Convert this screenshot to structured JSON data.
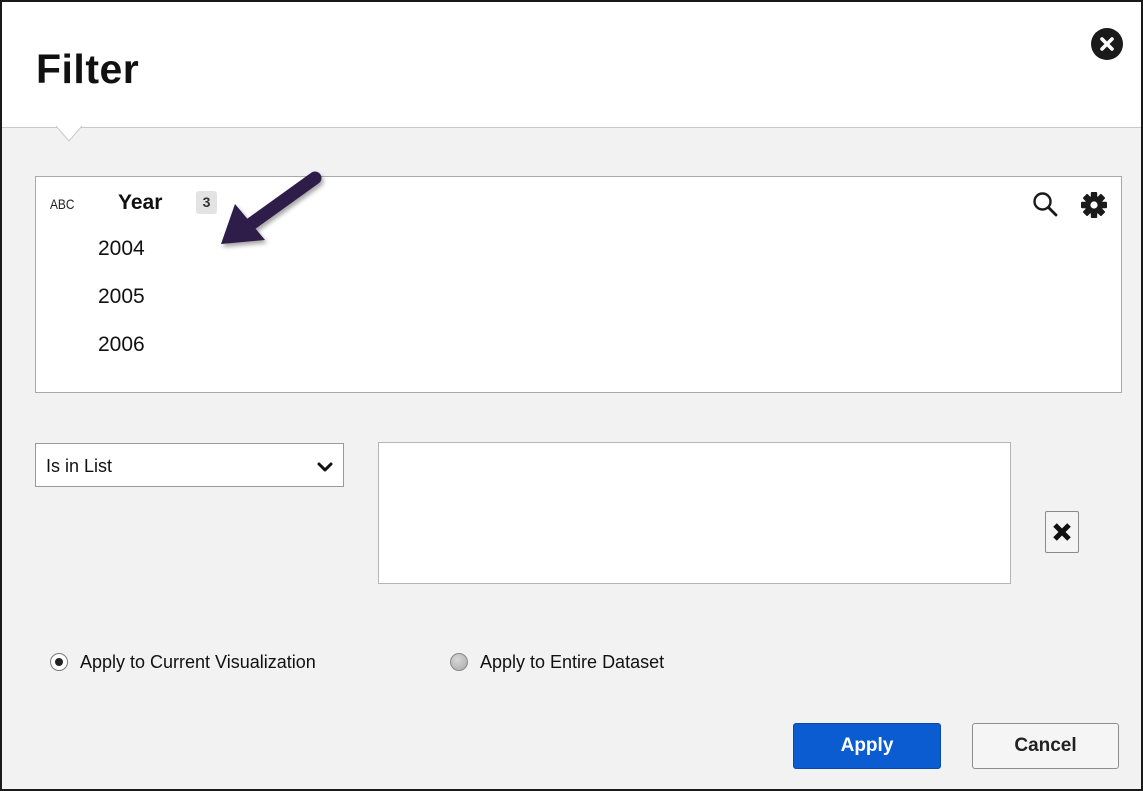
{
  "dialog": {
    "title": "Filter",
    "close_icon": "close-circle-icon"
  },
  "field": {
    "type_label": "ABC",
    "name": "Year",
    "count": "3",
    "values": [
      "2004",
      "2005",
      "2006"
    ],
    "search_icon": "search-icon",
    "settings_icon": "gear-icon"
  },
  "condition": {
    "operator": "Is in List",
    "values_text": "",
    "clear_icon": "times-icon"
  },
  "scope": {
    "options": [
      {
        "label": "Apply to Current Visualization",
        "checked": true
      },
      {
        "label": "Apply to Entire Dataset",
        "checked": false
      }
    ]
  },
  "actions": {
    "apply_label": "Apply",
    "cancel_label": "Cancel"
  },
  "colors": {
    "primary": "#0a5cd0",
    "annotation_arrow": "#2e1a4a"
  }
}
